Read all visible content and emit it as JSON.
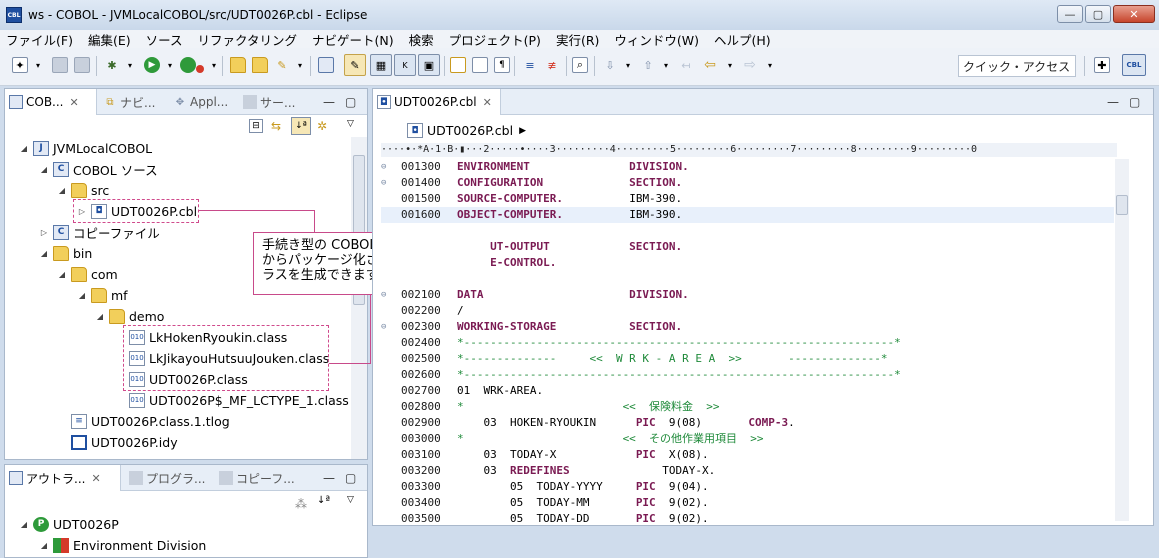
{
  "window": {
    "title": "ws - COBOL - JVMLocalCOBOL/src/UDT0026P.cbl - Eclipse",
    "app_icon_text": "CBL",
    "minimize": "—",
    "maximize": "▢",
    "close": "✕"
  },
  "menu": [
    "ファイル(F)",
    "編集(E)",
    "ソース",
    "リファクタリング",
    "ナビゲート(N)",
    "検索",
    "プロジェクト(P)",
    "実行(R)",
    "ウィンドウ(W)",
    "ヘルプ(H)"
  ],
  "toolbar": {
    "quick_access_placeholder": "クイック・アクセス"
  },
  "explorer": {
    "tabs": [
      "COB...",
      "ナビ...",
      "Appl...",
      "サー..."
    ],
    "tree": [
      {
        "label": "JVMLocalCOBOL",
        "twisty": "◢",
        "icon": "project"
      },
      {
        "label": "COBOL ソース",
        "twisty": "◢",
        "icon": "project"
      },
      {
        "label": "src",
        "twisty": "◢",
        "icon": "folder"
      },
      {
        "label": "UDT0026P.cbl",
        "twisty": "▷",
        "icon": "file"
      },
      {
        "label": "コピーファイル",
        "twisty": "▷",
        "icon": "project"
      },
      {
        "label": "bin",
        "twisty": "◢",
        "icon": "folder"
      },
      {
        "label": "com",
        "twisty": "◢",
        "icon": "folder"
      },
      {
        "label": "mf",
        "twisty": "◢",
        "icon": "folder"
      },
      {
        "label": "demo",
        "twisty": "◢",
        "icon": "folder"
      },
      {
        "label": "LkHokenRyoukin.class",
        "twisty": "",
        "icon": "class"
      },
      {
        "label": "LkJikayouHutsuuJouken.class",
        "twisty": "",
        "icon": "class"
      },
      {
        "label": "UDT0026P.class",
        "twisty": "",
        "icon": "class"
      },
      {
        "label": "UDT0026P$_MF_LCTYPE_1.class",
        "twisty": "",
        "icon": "class"
      },
      {
        "label": "UDT0026P.class.1.tlog",
        "twisty": "",
        "icon": "file"
      },
      {
        "label": "UDT0026P.idy",
        "twisty": "",
        "icon": "idy"
      }
    ],
    "callout": "手続き型の COBOL プログラムからパッケージ化された JVM クラスを生成できます。"
  },
  "outline": {
    "tabs": [
      "アウトラ...",
      "プログラ...",
      "コピーフ..."
    ],
    "tree": [
      {
        "label": "UDT0026P",
        "twisty": "◢"
      },
      {
        "label": "Environment Division",
        "twisty": "◢"
      }
    ]
  },
  "editor": {
    "tab": "UDT0026P.cbl",
    "breadcrumb": "UDT0026P.cbl",
    "ruler": "····•·*A·1·B·▮···2·····•····3·········4·········5·········6·········7·········8·········9·········0",
    "lines": [
      {
        "num": "001300",
        "fold": "⊖",
        "segs": [
          {
            "t": "ENVIRONMENT               DIVISION.",
            "c": "kw"
          }
        ]
      },
      {
        "num": "001400",
        "fold": "⊖",
        "segs": [
          {
            "t": "CONFIGURATION             SECTION.",
            "c": "kw"
          }
        ]
      },
      {
        "num": "001500",
        "fold": "",
        "segs": [
          {
            "t": "SOURCE-COMPUTER.",
            "c": "kw"
          },
          {
            "t": "          IBM-390.",
            "c": "nm"
          }
        ]
      },
      {
        "num": "001600",
        "fold": "",
        "hl": true,
        "segs": [
          {
            "t": "OBJECT-COMPUTER.",
            "c": "kw"
          },
          {
            "t": "          IBM-390.",
            "c": "nm"
          }
        ]
      },
      {
        "num": "",
        "fold": "",
        "segs": [
          {
            "t": "",
            "c": "nm"
          }
        ]
      },
      {
        "num": "",
        "fold": "",
        "segs": [
          {
            "t": "     UT-OUTPUT            SECTION.",
            "c": "kw"
          }
        ]
      },
      {
        "num": "",
        "fold": "",
        "segs": [
          {
            "t": "     E-CONTROL.",
            "c": "kw"
          }
        ]
      },
      {
        "num": "",
        "fold": "",
        "segs": [
          {
            "t": "",
            "c": "nm"
          }
        ]
      },
      {
        "num": "002100",
        "fold": "⊖",
        "segs": [
          {
            "t": "DATA                      DIVISION.",
            "c": "kw"
          }
        ]
      },
      {
        "num": "002200",
        "fold": "",
        "segs": [
          {
            "t": "/",
            "c": "nm"
          }
        ]
      },
      {
        "num": "002300",
        "fold": "⊖",
        "segs": [
          {
            "t": "WORKING-STORAGE           SECTION.",
            "c": "kw"
          }
        ]
      },
      {
        "num": "002400",
        "fold": "",
        "segs": [
          {
            "t": "*-----------------------------------------------------------------*",
            "c": "cm"
          }
        ]
      },
      {
        "num": "002500",
        "fold": "",
        "segs": [
          {
            "t": "*--------------     <<  W R K - A R E A  >>       --------------*",
            "c": "cm"
          }
        ]
      },
      {
        "num": "002600",
        "fold": "",
        "segs": [
          {
            "t": "*-----------------------------------------------------------------*",
            "c": "cm"
          }
        ]
      },
      {
        "num": "002700",
        "fold": "",
        "segs": [
          {
            "t": "01  WRK-AREA.",
            "c": "nm"
          }
        ]
      },
      {
        "num": "002800",
        "fold": "",
        "segs": [
          {
            "t": "*                        <<  保険料金  >>",
            "c": "cm"
          }
        ]
      },
      {
        "num": "002900",
        "fold": "",
        "segs": [
          {
            "t": "    03  HOKEN-RYOUKIN      ",
            "c": "nm"
          },
          {
            "t": "PIC",
            "c": "kw"
          },
          {
            "t": "  9(08)       ",
            "c": "nm"
          },
          {
            "t": "COMP-3",
            "c": "kw"
          },
          {
            "t": ".",
            "c": "nm"
          }
        ]
      },
      {
        "num": "003000",
        "fold": "",
        "segs": [
          {
            "t": "*                        <<  その他作業用項目  >>",
            "c": "cm"
          }
        ]
      },
      {
        "num": "003100",
        "fold": "",
        "segs": [
          {
            "t": "    03  TODAY-X            ",
            "c": "nm"
          },
          {
            "t": "PIC",
            "c": "kw"
          },
          {
            "t": "  X(08).",
            "c": "nm"
          }
        ]
      },
      {
        "num": "003200",
        "fold": "",
        "segs": [
          {
            "t": "    03  ",
            "c": "nm"
          },
          {
            "t": "REDEFINES",
            "c": "kw"
          },
          {
            "t": "              TODAY-X.",
            "c": "nm"
          }
        ]
      },
      {
        "num": "003300",
        "fold": "",
        "segs": [
          {
            "t": "        05  TODAY-YYYY     ",
            "c": "nm"
          },
          {
            "t": "PIC",
            "c": "kw"
          },
          {
            "t": "  9(04).",
            "c": "nm"
          }
        ]
      },
      {
        "num": "003400",
        "fold": "",
        "segs": [
          {
            "t": "        05  TODAY-MM       ",
            "c": "nm"
          },
          {
            "t": "PIC",
            "c": "kw"
          },
          {
            "t": "  9(02).",
            "c": "nm"
          }
        ]
      },
      {
        "num": "003500",
        "fold": "",
        "segs": [
          {
            "t": "        05  TODAY-DD       ",
            "c": "nm"
          },
          {
            "t": "PIC",
            "c": "kw"
          },
          {
            "t": "  9(02).",
            "c": "nm"
          }
        ]
      }
    ]
  }
}
